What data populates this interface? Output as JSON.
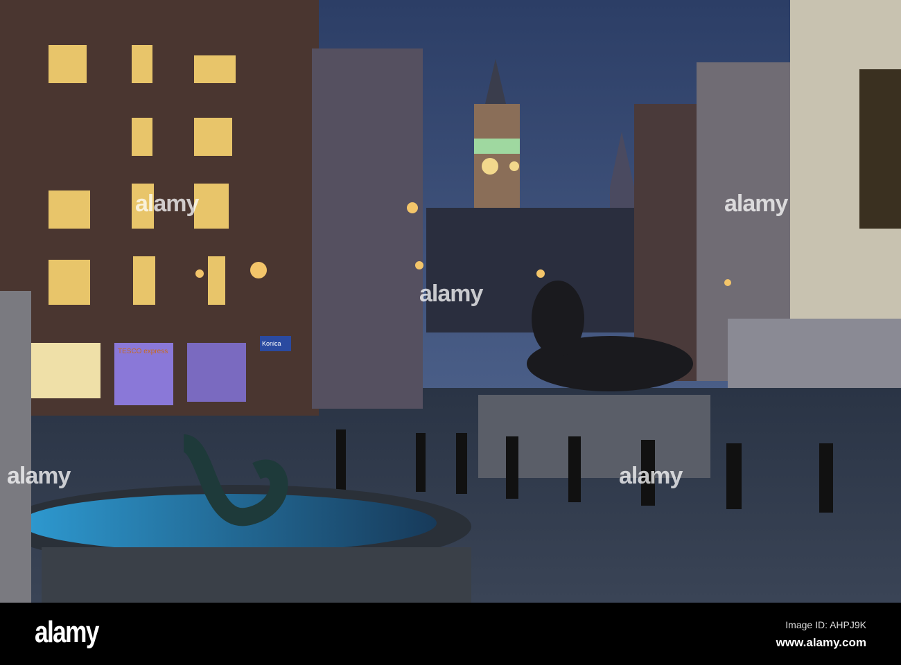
{
  "footer": {
    "logo": "alamy",
    "image_id": "Image ID: AHPJ9K",
    "website": "www.alamy.com"
  },
  "watermark": {
    "text": "alamy"
  },
  "signs": {
    "shop": "TESCO express",
    "shop2": "Konica"
  }
}
